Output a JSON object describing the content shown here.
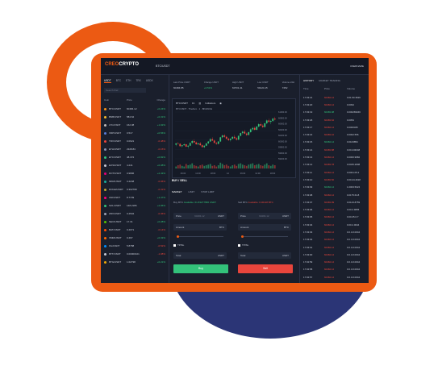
{
  "app": {
    "logo_a": "CREO",
    "logo_b": "CRYPTO",
    "pair": "BTC/USDT",
    "user": "USERNAME"
  },
  "market": {
    "tabs": [
      "USDT",
      "BTC",
      "ETH",
      "TRX",
      "USDX"
    ],
    "search_placeholder": "Search Pair",
    "headers": [
      "Coin",
      "Price",
      "Change"
    ],
    "rows": [
      {
        "pair": "BTC/USDT",
        "price": "60484.12",
        "change": "+0.24%",
        "dir": "up",
        "color": "#f7931a"
      },
      {
        "pair": "BNB/USDT",
        "price": "584.62",
        "change": "+0.31%",
        "dir": "up",
        "color": "#f3ba2f"
      },
      {
        "pair": "LTC/USDT",
        "price": "162.08",
        "change": "+1.02%",
        "dir": "up",
        "color": "#bfbbbb"
      },
      {
        "pair": "XRP/USDT",
        "price": "0.517",
        "change": "+0.56%",
        "dir": "up",
        "color": "#5a7dd6"
      },
      {
        "pair": "TRX/USDT",
        "price": "0.0621",
        "change": "-0.48%",
        "dir": "dn",
        "color": "#e8453c"
      },
      {
        "pair": "ETH/USDT",
        "price": "2328.84",
        "change": "-0.15%",
        "dir": "dn",
        "color": "#8a92b2"
      },
      {
        "pair": "ETC/USDT",
        "price": "48.372",
        "change": "+0.82%",
        "dir": "up",
        "color": "#33c27a"
      },
      {
        "pair": "EOS/USDT",
        "price": "4.241",
        "change": "+0.38%",
        "dir": "up",
        "color": "#c5cad6"
      },
      {
        "pair": "DOT/USDT",
        "price": "0.9896",
        "change": "+2.43%",
        "dir": "up",
        "color": "#e6007a"
      },
      {
        "pair": "MKR/USDT",
        "price": "3.4248",
        "change": "-0.06%",
        "dir": "dn",
        "color": "#1aab9b"
      },
      {
        "pair": "DOGE/USDT",
        "price": "0.302798",
        "change": "-0.31%",
        "dir": "dn",
        "color": "#c2a633"
      },
      {
        "pair": "UNI/USDT",
        "price": "8.7739",
        "change": "+1.47%",
        "dir": "up",
        "color": "#ff007a"
      },
      {
        "pair": "SOL/USDT",
        "price": "148.2186",
        "change": "+2.05%",
        "dir": "up",
        "color": "#33c27a"
      },
      {
        "pair": "ZRX/USDT",
        "price": "0.4504",
        "change": "-0.36%",
        "dir": "dn",
        "color": "#9aa1b3"
      },
      {
        "pair": "NEO/USDT",
        "price": "17.31",
        "change": "+0.28%",
        "dir": "up",
        "color": "#58bf00"
      },
      {
        "pair": "BAT/USDT",
        "price": "0.4071",
        "change": "-0.14%",
        "dir": "dn",
        "color": "#ff5000"
      },
      {
        "pair": "XMR/USDT",
        "price": "0.497",
        "change": "+0.33%",
        "dir": "up",
        "color": "#ff6600"
      },
      {
        "pair": "FIL/USDT",
        "price": "5.8788",
        "change": "-0.52%",
        "dir": "dn",
        "color": "#0090ff"
      },
      {
        "pair": "BTT/USDT",
        "price": "0.00000101",
        "change": "-1.08%",
        "dir": "dn",
        "color": "#c5cad6"
      },
      {
        "pair": "BTG/USDT",
        "price": "1.02738",
        "change": "+0.21%",
        "dir": "up",
        "color": "#eba809"
      }
    ]
  },
  "stats": [
    {
      "label": "Last Price USDT",
      "value": "60484.85",
      "dir": "none"
    },
    {
      "label": "Change USDT",
      "value": "+0.51%",
      "dir": "up"
    },
    {
      "label": "High USDT",
      "value": "60731.41",
      "dir": "none"
    },
    {
      "label": "Low USDT",
      "value": "59124.15",
      "dir": "none"
    },
    {
      "label": "Volume 24H",
      "value": "7452",
      "dir": "none"
    }
  ],
  "chart_toolbar": {
    "pair": "BTC/USDT",
    "interval": "1h",
    "indicators": "Indicators"
  },
  "chart_info": "BTCUSDT · TheZero · 1 · BINANCE",
  "chart_data": {
    "type": "candlestick",
    "ohlc": [
      [
        0.3,
        0.34,
        0.27,
        0.33
      ],
      [
        0.33,
        0.36,
        0.31,
        0.32
      ],
      [
        0.32,
        0.33,
        0.26,
        0.27
      ],
      [
        0.27,
        0.3,
        0.24,
        0.29
      ],
      [
        0.29,
        0.33,
        0.28,
        0.31
      ],
      [
        0.31,
        0.32,
        0.25,
        0.26
      ],
      [
        0.26,
        0.29,
        0.22,
        0.28
      ],
      [
        0.28,
        0.35,
        0.27,
        0.34
      ],
      [
        0.34,
        0.4,
        0.32,
        0.38
      ],
      [
        0.38,
        0.42,
        0.34,
        0.35
      ],
      [
        0.35,
        0.37,
        0.3,
        0.31
      ],
      [
        0.31,
        0.34,
        0.29,
        0.33
      ],
      [
        0.33,
        0.36,
        0.28,
        0.29
      ],
      [
        0.29,
        0.31,
        0.24,
        0.25
      ],
      [
        0.25,
        0.29,
        0.23,
        0.28
      ],
      [
        0.28,
        0.34,
        0.27,
        0.33
      ],
      [
        0.33,
        0.38,
        0.32,
        0.37
      ],
      [
        0.37,
        0.44,
        0.36,
        0.42
      ],
      [
        0.42,
        0.46,
        0.38,
        0.39
      ],
      [
        0.39,
        0.41,
        0.33,
        0.34
      ],
      [
        0.34,
        0.36,
        0.3,
        0.32
      ],
      [
        0.32,
        0.38,
        0.31,
        0.37
      ],
      [
        0.37,
        0.47,
        0.36,
        0.46
      ],
      [
        0.46,
        0.52,
        0.44,
        0.5
      ],
      [
        0.5,
        0.53,
        0.45,
        0.47
      ],
      [
        0.47,
        0.49,
        0.41,
        0.43
      ],
      [
        0.43,
        0.45,
        0.38,
        0.4
      ],
      [
        0.4,
        0.44,
        0.37,
        0.43
      ],
      [
        0.43,
        0.48,
        0.42,
        0.47
      ],
      [
        0.47,
        0.51,
        0.43,
        0.44
      ],
      [
        0.44,
        0.46,
        0.39,
        0.41
      ],
      [
        0.41,
        0.5,
        0.4,
        0.49
      ],
      [
        0.49,
        0.56,
        0.48,
        0.55
      ],
      [
        0.55,
        0.6,
        0.52,
        0.58
      ],
      [
        0.58,
        0.62,
        0.53,
        0.54
      ],
      [
        0.54,
        0.56,
        0.49,
        0.51
      ],
      [
        0.51,
        0.58,
        0.5,
        0.57
      ],
      [
        0.57,
        0.65,
        0.56,
        0.63
      ],
      [
        0.63,
        0.68,
        0.6,
        0.66
      ],
      [
        0.66,
        0.69,
        0.61,
        0.62
      ],
      [
        0.62,
        0.7,
        0.61,
        0.69
      ],
      [
        0.69,
        0.76,
        0.67,
        0.74
      ],
      [
        0.74,
        0.78,
        0.7,
        0.71
      ],
      [
        0.71,
        0.74,
        0.66,
        0.68
      ],
      [
        0.68,
        0.77,
        0.67,
        0.76
      ],
      [
        0.76,
        0.84,
        0.74,
        0.82
      ],
      [
        0.82,
        0.86,
        0.77,
        0.79
      ],
      [
        0.79,
        0.83,
        0.74,
        0.81
      ],
      [
        0.81,
        0.88,
        0.79,
        0.86
      ],
      [
        0.86,
        0.9,
        0.82,
        0.84
      ]
    ],
    "volume": [
      0.3,
      0.5,
      0.6,
      0.4,
      0.3,
      0.7,
      0.5,
      0.6,
      0.8,
      0.5,
      0.4,
      0.3,
      0.5,
      0.6,
      0.4,
      0.5,
      0.6,
      0.7,
      0.4,
      0.5,
      0.3,
      0.5,
      0.9,
      0.7,
      0.5,
      0.6,
      0.4,
      0.3,
      0.5,
      0.6,
      0.4,
      0.7,
      0.8,
      0.6,
      0.5,
      0.4,
      0.6,
      0.7,
      0.8,
      0.5,
      0.6,
      0.7,
      0.5,
      0.4,
      0.6,
      0.8,
      0.5,
      0.4,
      0.6,
      0.5
    ],
    "y_ticks": [
      "61000.00",
      "60800.00",
      "60600.00",
      "60400.00",
      "60200.00",
      "60000.00",
      "59800.00",
      "59600.00",
      "59400.00"
    ],
    "x_ticks": [
      "06:00",
      "12:00",
      "18:00",
      "12",
      "06:00",
      "12:00",
      "18:00"
    ]
  },
  "order": {
    "header": "BUY / SELL",
    "tabs": [
      "MARKET",
      "LIMIT",
      "STOP LIMIT"
    ],
    "buy_avail_label": "Buy BTC",
    "buy_avail_value": "Available: 61.83277586 USDT",
    "sell_avail_label": "Sell BTC",
    "sell_avail_value": "Available: 0.00118 BTC",
    "price_label": "Price",
    "price_value": "60484.12",
    "quote_unit": "USDT",
    "amount_label": "Amount",
    "base_unit": "BTC",
    "tpsl": "TP/SL",
    "total_label": "Total",
    "buy_button": "Buy",
    "sell_button": "Sell"
  },
  "history": {
    "tabs": [
      "HISTORY",
      "MARKET TRADING"
    ],
    "headers": [
      "Time",
      "Price",
      "Volume"
    ],
    "rows": [
      {
        "time": "17:03:21",
        "price": "60484.12",
        "vol": "0.01.50.3526",
        "dir": "dn"
      },
      {
        "time": "17:03:20",
        "price": "60484.12",
        "vol": "0.0094",
        "dir": "dn"
      },
      {
        "time": "17:03:19",
        "price": "60483.98",
        "vol": "0.000283346",
        "dir": "up"
      },
      {
        "time": "17:03:18",
        "price": "60483.62",
        "vol": "0.0054",
        "dir": "dn"
      },
      {
        "time": "17:03:17",
        "price": "60484.12",
        "vol": "0.0000325",
        "dir": "dn"
      },
      {
        "time": "17:03:16",
        "price": "60483.10",
        "vol": "0.0002.556",
        "dir": "dn"
      },
      {
        "time": "17:03:15",
        "price": "60484.12",
        "vol": "0.0103854",
        "dir": "up"
      },
      {
        "time": "17:03:14",
        "price": "60483.88",
        "vol": "0.00.443048",
        "dir": "dn"
      },
      {
        "time": "17:03:13",
        "price": "60484.12",
        "vol": "0.0000.9982",
        "dir": "dn"
      },
      {
        "time": "17:03:12",
        "price": "60483.78",
        "vol": "0.0025.2808",
        "dir": "dn"
      },
      {
        "time": "17:03:11",
        "price": "60484.12",
        "vol": "0.0001.05.2",
        "dir": "dn"
      },
      {
        "time": "17:03:10",
        "price": "60483.50",
        "vol": "0.00.44.4018",
        "dir": "dn"
      },
      {
        "time": "17:03:09",
        "price": "60484.12",
        "vol": "1.0003.5024",
        "dir": "up"
      },
      {
        "time": "17:03:08",
        "price": "60484.12",
        "vol": "0.0175.64.8",
        "dir": "dn"
      },
      {
        "time": "17:03:07",
        "price": "60483.99",
        "vol": "0.0123.8759",
        "dir": "dn"
      },
      {
        "time": "17:03:06",
        "price": "60484.12",
        "vol": "0.00.4.9055",
        "dir": "dn"
      },
      {
        "time": "17:03:05",
        "price": "60484.12",
        "vol": "0.00.25.0.7",
        "dir": "dn"
      },
      {
        "time": "17:03:04",
        "price": "60484.12",
        "vol": "0.00.4.0044",
        "dir": "dn"
      },
      {
        "time": "17:03:03",
        "price": "60484.12",
        "vol": "0.0.4.0.0044",
        "dir": "dn"
      },
      {
        "time": "17:03:02",
        "price": "60484.12",
        "vol": "0.0.4.0.0044",
        "dir": "dn"
      },
      {
        "time": "17:03:01",
        "price": "60484.12",
        "vol": "0.0.4.0.0044",
        "dir": "dn"
      },
      {
        "time": "17:03:00",
        "price": "60484.12",
        "vol": "0.0.4.0.0044",
        "dir": "dn"
      },
      {
        "time": "17:02:59",
        "price": "60484.12",
        "vol": "0.0.4.0.0044",
        "dir": "dn"
      },
      {
        "time": "17:02:58",
        "price": "60484.12",
        "vol": "0.0.4.0.0044",
        "dir": "dn"
      },
      {
        "time": "17:02:57",
        "price": "60484.12",
        "vol": "0.0.4.0.0044",
        "dir": "dn"
      },
      {
        "time": "17:02:56",
        "price": "60484.12",
        "vol": "0.0.4.0.0044",
        "dir": "dn"
      }
    ]
  },
  "colors": {
    "accent": "#ec5a13",
    "up": "#33c27a",
    "down": "#e8453c",
    "navy": "#2b3576"
  }
}
